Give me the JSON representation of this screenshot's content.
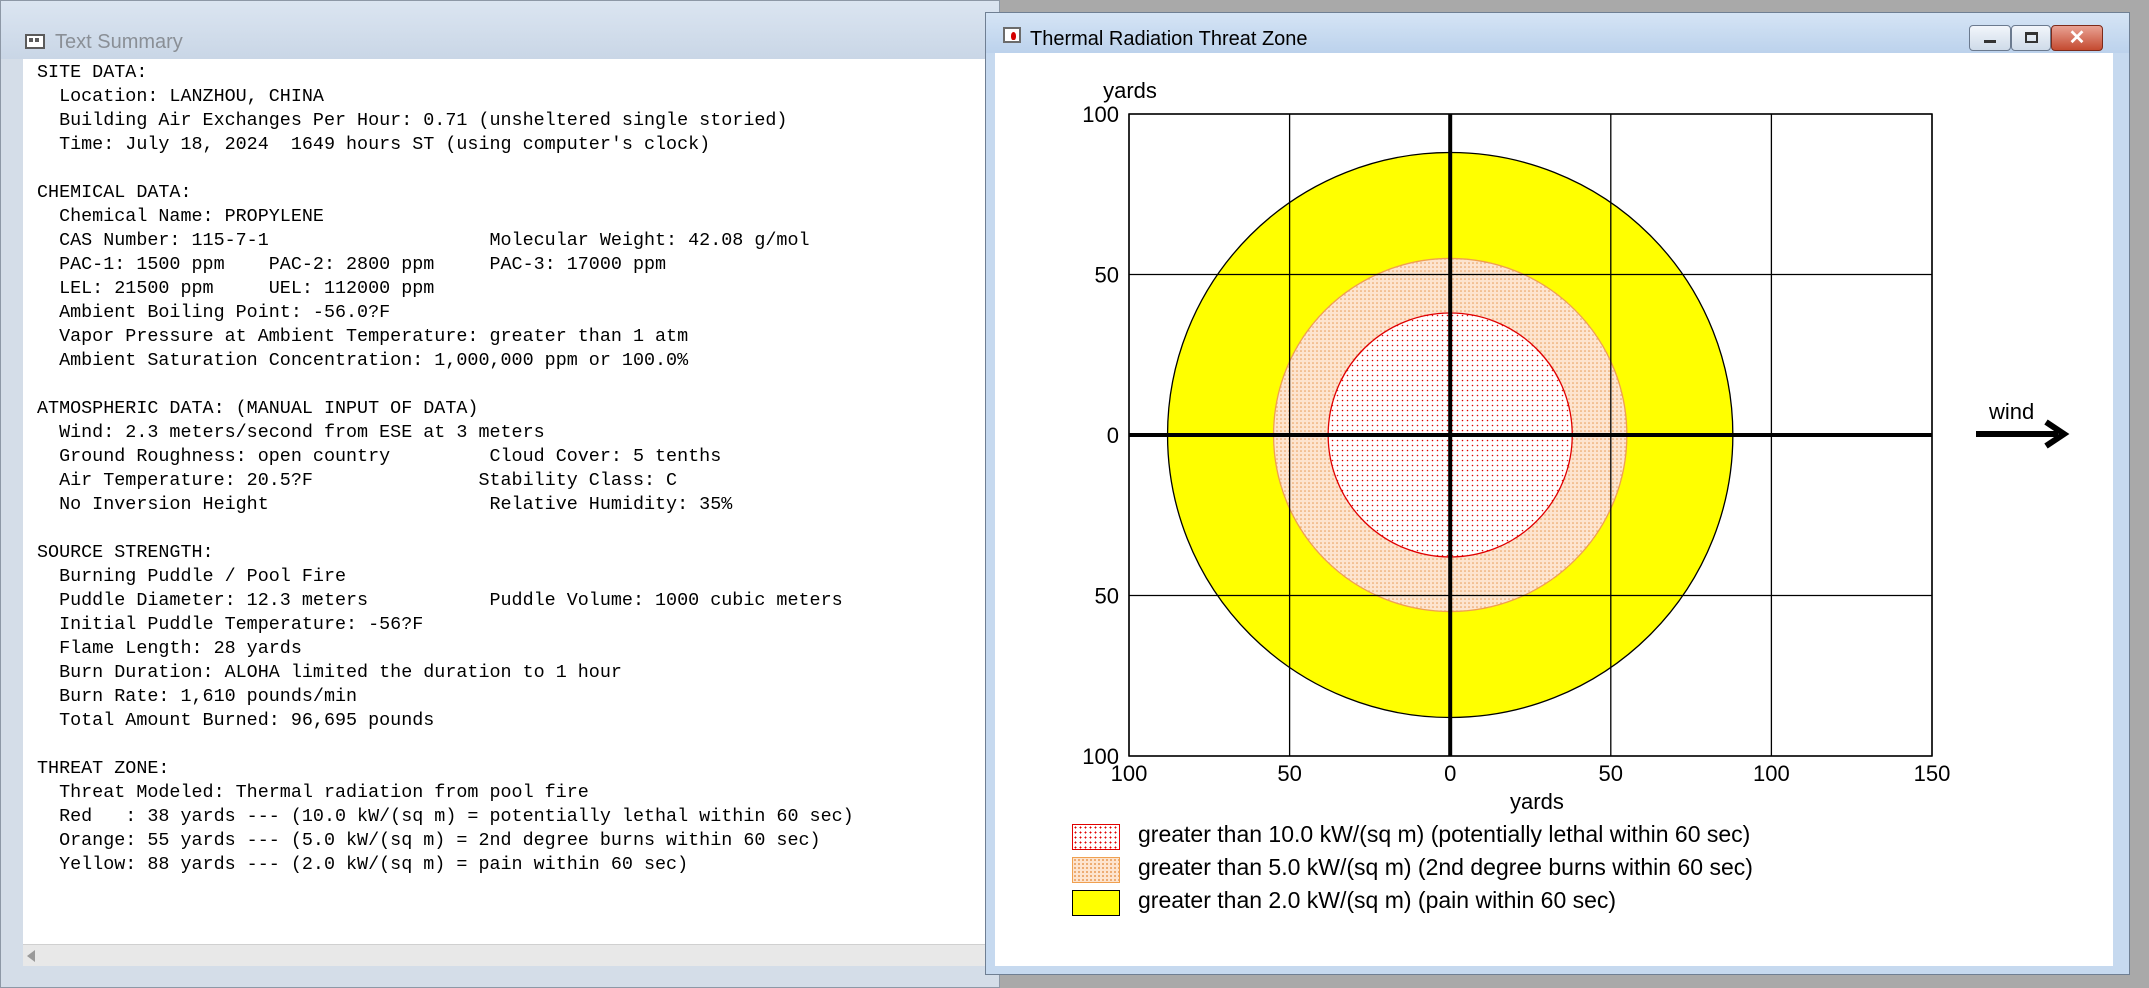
{
  "text_window": {
    "title": "Text Summary",
    "lines": [
      "SITE DATA:",
      "  Location: LANZHOU, CHINA",
      "  Building Air Exchanges Per Hour: 0.71 (unsheltered single storied)",
      "  Time: July 18, 2024  1649 hours ST (using computer's clock)",
      "",
      "CHEMICAL DATA:",
      "  Chemical Name: PROPYLENE",
      "  CAS Number: 115-7-1                    Molecular Weight: 42.08 g/mol",
      "  PAC-1: 1500 ppm    PAC-2: 2800 ppm     PAC-3: 17000 ppm",
      "  LEL: 21500 ppm     UEL: 112000 ppm",
      "  Ambient Boiling Point: -56.0?F",
      "  Vapor Pressure at Ambient Temperature: greater than 1 atm",
      "  Ambient Saturation Concentration: 1,000,000 ppm or 100.0%",
      "",
      "ATMOSPHERIC DATA: (MANUAL INPUT OF DATA)",
      "  Wind: 2.3 meters/second from ESE at 3 meters",
      "  Ground Roughness: open country         Cloud Cover: 5 tenths",
      "  Air Temperature: 20.5?F               Stability Class: C",
      "  No Inversion Height                    Relative Humidity: 35%",
      "",
      "SOURCE STRENGTH:",
      "  Burning Puddle / Pool Fire",
      "  Puddle Diameter: 12.3 meters           Puddle Volume: 1000 cubic meters",
      "  Initial Puddle Temperature: -56?F",
      "  Flame Length: 28 yards",
      "  Burn Duration: ALOHA limited the duration to 1 hour",
      "  Burn Rate: 1,610 pounds/min",
      "  Total Amount Burned: 96,695 pounds",
      "",
      "THREAT ZONE:",
      "  Threat Modeled: Thermal radiation from pool fire",
      "  Red   : 38 yards --- (10.0 kW/(sq m) = potentially lethal within 60 sec)",
      "  Orange: 55 yards --- (5.0 kW/(sq m) = 2nd degree burns within 60 sec)",
      "  Yellow: 88 yards --- (2.0 kW/(sq m) = pain within 60 sec)"
    ]
  },
  "threat_window": {
    "title": "Thermal Radiation Threat Zone",
    "close_glyph": "✕",
    "wind_label": "wind",
    "legend": [
      {
        "id": "red",
        "label": "greater than 10.0 kW/(sq m) (potentially lethal within 60 sec)"
      },
      {
        "id": "orange",
        "label": "greater than 5.0 kW/(sq m) (2nd degree burns within 60 sec)"
      },
      {
        "id": "yellow",
        "label": "greater than 2.0 kW/(sq m) (pain within 60 sec)"
      }
    ]
  },
  "chart_data": {
    "type": "area",
    "xlabel": "yards",
    "ylabel": "yards",
    "xlim": [
      -100,
      150
    ],
    "ylim": [
      -100,
      100
    ],
    "x_ticks": [
      -100,
      -50,
      0,
      50,
      100,
      150
    ],
    "x_tick_labels": [
      "100",
      "50",
      "0",
      "50",
      "100",
      "150"
    ],
    "y_ticks": [
      100,
      50,
      0,
      -50,
      -100
    ],
    "y_tick_labels": [
      "100",
      "50",
      "0",
      "50",
      "100"
    ],
    "grid": true,
    "legend_position": "bottom",
    "zones": [
      {
        "id": "yellow",
        "radius": 88,
        "fill": "#ffff00",
        "stroke": "#000000"
      },
      {
        "id": "orange",
        "radius": 55,
        "fill": "#fde4cf",
        "stroke": "#f0a050"
      },
      {
        "id": "red",
        "radius": 38,
        "fill": "#ffffff",
        "stroke": "#e00000"
      }
    ]
  }
}
